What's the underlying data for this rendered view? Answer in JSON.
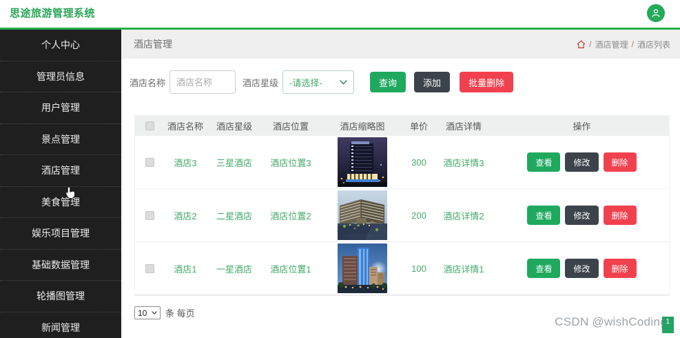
{
  "app": {
    "title": "思途旅游管理系统"
  },
  "sidebar": {
    "items": [
      {
        "label": "个人中心"
      },
      {
        "label": "管理员信息"
      },
      {
        "label": "用户管理"
      },
      {
        "label": "景点管理"
      },
      {
        "label": "酒店管理"
      },
      {
        "label": "美食管理"
      },
      {
        "label": "娱乐项目管理"
      },
      {
        "label": "基础数据管理"
      },
      {
        "label": "轮播图管理"
      },
      {
        "label": "新闻管理"
      }
    ]
  },
  "breadcrumb": {
    "title": "酒店管理",
    "separator": "/",
    "items": [
      "酒店管理",
      "酒店列表"
    ]
  },
  "filters": {
    "name_label": "酒店名称",
    "name_placeholder": "酒店名称",
    "name_value": "",
    "star_label": "酒店星级",
    "star_value": "-请选择-"
  },
  "actions": {
    "search": "查询",
    "add": "添加",
    "batch_delete": "批量删除"
  },
  "table": {
    "headers": [
      "酒店名称",
      "酒店星级",
      "酒店位置",
      "酒店缩略图",
      "单价",
      "酒店详情",
      "操作"
    ],
    "rows": [
      {
        "name": "酒店3",
        "star": "三星酒店",
        "location": "酒店位置3",
        "thumb": "night-skyscraper-hotel-photo",
        "price": "300",
        "detail": "酒店详情3"
      },
      {
        "name": "酒店2",
        "star": "二星酒店",
        "location": "酒店位置2",
        "thumb": "dusk-resort-hotel-photo",
        "price": "200",
        "detail": "酒店详情2"
      },
      {
        "name": "酒店1",
        "star": "一星酒店",
        "location": "酒店位置1",
        "thumb": "evening-tower-hotel-photo",
        "price": "100",
        "detail": "酒店详情1"
      }
    ],
    "row_actions": {
      "view": "查看",
      "edit": "修改",
      "delete": "删除"
    }
  },
  "pagination": {
    "page_size": "10",
    "suffix": "条 每页"
  },
  "watermark": {
    "text": "CSDN @wishCoding",
    "badge": "1"
  },
  "colors": {
    "accent_green": "#1fa95f",
    "dark_button": "#3c434a",
    "danger_red": "#f2414e",
    "link_green": "#44aa6b",
    "top_border_green": "#22b14c",
    "sidebar_bg": "#1f1f1f"
  }
}
